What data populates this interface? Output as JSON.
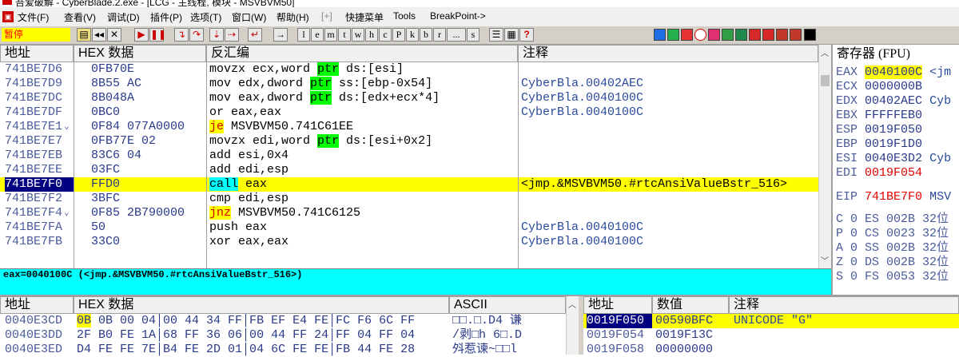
{
  "window": {
    "title": "吾爱破解 - CyberBlade.2.exe - [LCG - 主线程, 模块 - MSVBVM50]"
  },
  "menu": {
    "items": [
      "文件(F)",
      "查看(V)",
      "调试(D)",
      "插件(P)",
      "选项(T)",
      "窗口(W)",
      "帮助(H)",
      "[+]",
      "快捷菜单",
      "Tools",
      "BreakPoint->"
    ]
  },
  "toolbar": {
    "status": "暂停",
    "letters": [
      "l",
      "e",
      "m",
      "t",
      "w",
      "h",
      "c",
      "P",
      "k",
      "b",
      "r",
      "...",
      "s"
    ],
    "help": "?"
  },
  "cpu": {
    "headers": {
      "address": "地址",
      "hex": "HEX 数据",
      "disasm": "反汇编",
      "comment": "注释"
    },
    "rows": [
      {
        "addr": "741BE7D6",
        "hex": "0FB70E",
        "pre": "movzx ecx,word ",
        "kw": "ptr",
        "post": " ds:[esi]",
        "comment": ""
      },
      {
        "addr": "741BE7D9",
        "hex": "8B55 AC",
        "pre": "mov edx,dword ",
        "kw": "ptr",
        "post": " ss:[ebp-0x54]",
        "comment": "CyberBla.00402AEC"
      },
      {
        "addr": "741BE7DC",
        "hex": "8B048A",
        "pre": "mov eax,dword ",
        "kw": "ptr",
        "post": " ds:[edx+ecx*4]",
        "comment": "CyberBla.0040100C"
      },
      {
        "addr": "741BE7DF",
        "hex": "0BC0",
        "pre": "or eax,eax",
        "kw": "",
        "post": "",
        "comment": "CyberBla.0040100C"
      },
      {
        "addr": "741BE7E1",
        "hex": "0F84 077A0000",
        "pre": "",
        "kw": "je",
        "post": " MSVBVM50.741C61EE",
        "comment": "",
        "arrow": "⌄",
        "kwyel": true
      },
      {
        "addr": "741BE7E7",
        "hex": "0FB77E 02",
        "pre": "movzx edi,word ",
        "kw": "ptr",
        "post": " ds:[esi+0x2]",
        "comment": ""
      },
      {
        "addr": "741BE7EB",
        "hex": "83C6 04",
        "pre": "add esi,0x4",
        "kw": "",
        "post": "",
        "comment": ""
      },
      {
        "addr": "741BE7EE",
        "hex": "03FC",
        "pre": "add edi,esp",
        "kw": "",
        "post": "",
        "comment": ""
      },
      {
        "addr": "741BE7F0",
        "hex": "FFD0",
        "pre": "",
        "kw": "call",
        "post": " eax",
        "comment": "<jmp.&MSVBVM50.#rtcAnsiValueBstr_516>",
        "current": true
      },
      {
        "addr": "741BE7F2",
        "hex": "3BFC",
        "pre": "cmp edi,esp",
        "kw": "",
        "post": "",
        "comment": ""
      },
      {
        "addr": "741BE7F4",
        "hex": "0F85 2B790000",
        "pre": "",
        "kw": "jnz",
        "post": " MSVBVM50.741C6125",
        "comment": "",
        "arrow": "⌄",
        "kwyel": true
      },
      {
        "addr": "741BE7FA",
        "hex": "50",
        "pre": "push eax",
        "kw": "",
        "post": "",
        "comment": "CyberBla.0040100C"
      },
      {
        "addr": "741BE7FB",
        "hex": "33C0",
        "pre": "xor eax,eax",
        "kw": "",
        "post": "",
        "comment": "CyberBla.0040100C"
      }
    ],
    "info": "eax=0040100C (<jmp.&MSVBVM50.#rtcAnsiValueBstr_516>)"
  },
  "registers": {
    "header": "寄存器 (FPU)",
    "regs": [
      {
        "name": "EAX",
        "val": "0040100C",
        "extra": "<jm",
        "hl": true
      },
      {
        "name": "ECX",
        "val": "0000000B",
        "extra": ""
      },
      {
        "name": "EDX",
        "val": "00402AEC",
        "extra": "Cyb"
      },
      {
        "name": "EBX",
        "val": "FFFFFEB0",
        "extra": ""
      },
      {
        "name": "ESP",
        "val": "0019F050",
        "extra": ""
      },
      {
        "name": "EBP",
        "val": "0019F1D0",
        "extra": ""
      },
      {
        "name": "ESI",
        "val": "0040E3D2",
        "extra": "Cyb"
      },
      {
        "name": "EDI",
        "val": "0019F054",
        "extra": "",
        "red": true
      }
    ],
    "eip": {
      "name": "EIP",
      "val": "741BE7F0",
      "extra": "MSV"
    },
    "flags": [
      {
        "f": "C 0",
        "seg": "ES 002B 32位"
      },
      {
        "f": "P 0",
        "seg": "CS 0023 32位"
      },
      {
        "f": "A 0",
        "seg": "SS 002B 32位"
      },
      {
        "f": "Z 0",
        "seg": "DS 002B 32位"
      },
      {
        "f": "S 0",
        "seg": "FS 0053 32位"
      }
    ]
  },
  "dump": {
    "headers": {
      "address": "地址",
      "hex": "HEX 数据",
      "ascii": "ASCII"
    },
    "rows": [
      {
        "addr": "0040E3CD",
        "b1": "0B",
        "rest": "0B 00 04│00 44 34 FF│FB EF E4 FE│FC F6 6C FF",
        "ascii": "□□.□.D4    谦"
      },
      {
        "addr": "0040E3DD",
        "b1": "2F",
        "rest": "B0 FE 1A│68 FF 36 06│00 44 FF 24│FF 04 FF 04",
        "ascii": "/剥□h  6□.D"
      },
      {
        "addr": "0040E3ED",
        "b1": "D4",
        "rest": "FE FE 7E│B4 FE 2D 01│04 6C FE FE│FB 44 FE 28",
        "ascii": "斘惹谏~□□l"
      }
    ]
  },
  "stack": {
    "headers": {
      "address": "地址",
      "value": "数值",
      "comment": "注释"
    },
    "rows": [
      {
        "addr": "0019F050",
        "val": "00590BFC",
        "comment": "UNICODE \"G\"",
        "current": true
      },
      {
        "addr": "0019F054",
        "val": "0019F13C",
        "comment": ""
      },
      {
        "addr": "0019F058",
        "val": "00000000",
        "comment": ""
      }
    ]
  }
}
